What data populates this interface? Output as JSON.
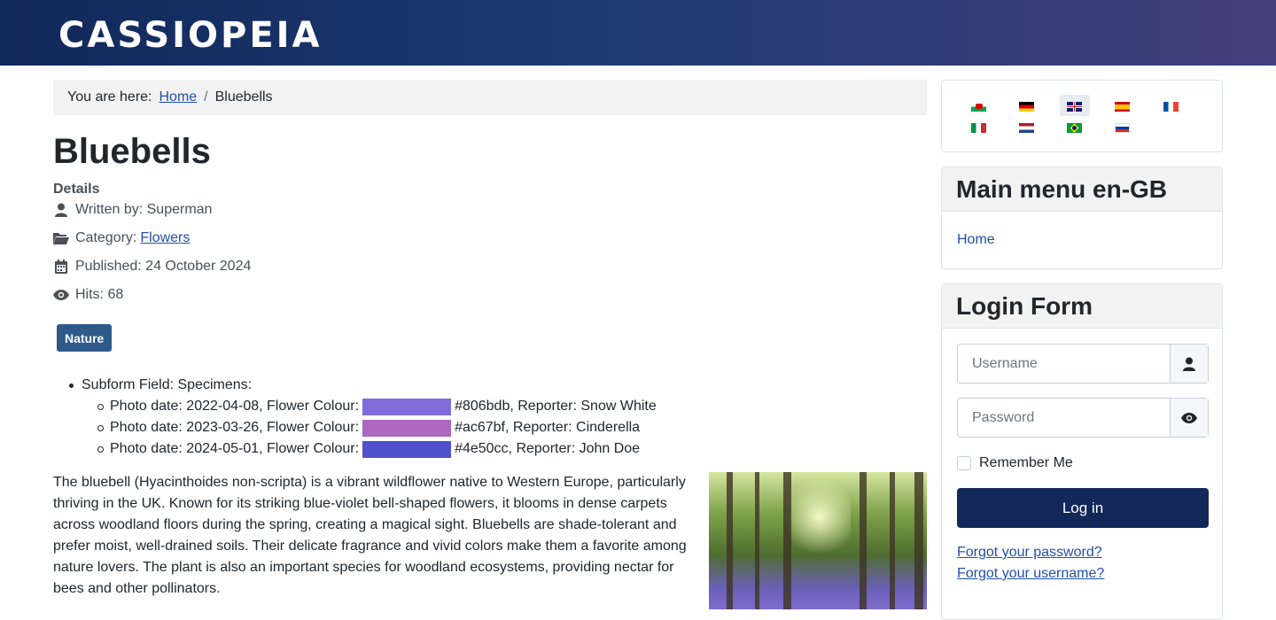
{
  "header": {
    "brand": "CASSIOPEIA"
  },
  "breadcrumb": {
    "label": "You are here:",
    "home": "Home",
    "separator": "/",
    "current": "Bluebells"
  },
  "article": {
    "title": "Bluebells",
    "details_label": "Details",
    "written_by": "Written by: Superman",
    "category_label": "Category:",
    "category": "Flowers",
    "published": "Published: 24 October 2024",
    "hits": "Hits: 68",
    "tag": "Nature",
    "subform_title": "Subform Field: Specimens:",
    "specimens": [
      {
        "date_text": "Photo date: 2022-04-08, Flower Colour:",
        "color": "#806bdb",
        "rest": "#806bdb, Reporter: Snow White"
      },
      {
        "date_text": "Photo date: 2023-03-26, Flower Colour:",
        "color": "#ac67bf",
        "rest": "#ac67bf, Reporter: Cinderella"
      },
      {
        "date_text": "Photo date: 2024-05-01, Flower Colour:",
        "color": "#4e50cc",
        "rest": "#4e50cc, Reporter: John Doe"
      }
    ],
    "body": "The bluebell (Hyacinthoides non-scripta) is a vibrant wildflower native to Western Europe, particularly thriving in the UK. Known for its striking blue-violet bell-shaped flowers, it blooms in dense carpets across woodland floors during the spring, creating a magical sight. Bluebells are shade-tolerant and prefer moist, well-drained soils. Their delicate fragrance and vivid colors make them a favorite among nature lovers. The plant is also an important species for woodland ecosystems, providing nectar for bees and other pollinators."
  },
  "languages": [
    "cy-GB",
    "de-DE",
    "en-GB",
    "es-ES",
    "fr-FR",
    "it-IT",
    "nl-NL",
    "pt-BR",
    "ru-RU"
  ],
  "main_menu": {
    "title": "Main menu en-GB",
    "items": [
      "Home"
    ]
  },
  "login": {
    "title": "Login Form",
    "username_placeholder": "Username",
    "password_placeholder": "Password",
    "remember": "Remember Me",
    "button": "Log in",
    "forgot_password": "Forgot your password?",
    "forgot_username": "Forgot your username?"
  },
  "colors": {
    "header_start": "#112859",
    "header_end": "#433f7c",
    "link": "#224faa",
    "tag": "#2e5a8a",
    "button": "#112859"
  }
}
